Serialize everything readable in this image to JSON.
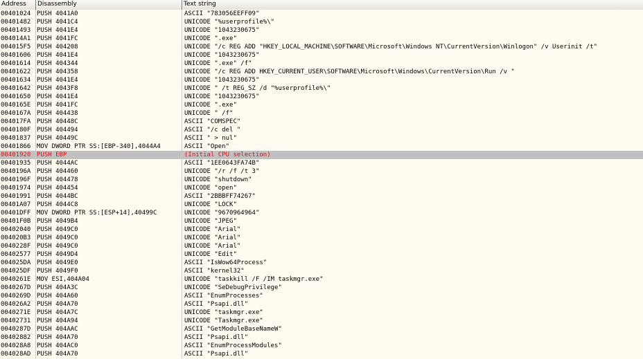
{
  "columns": {
    "address": "Address",
    "disassembly": "Disassembly",
    "text": "Text string"
  },
  "selection_color": "#ff0000",
  "rows": [
    {
      "addr": "00401024",
      "dis": "PUSH 4041A0",
      "txt": "ASCII \"783056EEFF09\""
    },
    {
      "addr": "00401482",
      "dis": "PUSH 4041C4",
      "txt": "UNICODE \"%userprofile%\\\""
    },
    {
      "addr": "00401493",
      "dis": "PUSH 4041E4",
      "txt": "UNICODE \"1043230675\""
    },
    {
      "addr": "004014A1",
      "dis": "PUSH 4041FC",
      "txt": "UNICODE \".exe\""
    },
    {
      "addr": "004015F5",
      "dis": "PUSH 404208",
      "txt": "UNICODE \"/c REG ADD \"HKEY_LOCAL_MACHINE\\SOFTWARE\\Microsoft\\Windows NT\\CurrentVersion\\Winlogon\" /v Userinit /t\""
    },
    {
      "addr": "00401606",
      "dis": "PUSH 4041E4",
      "txt": "UNICODE \"1043230675\""
    },
    {
      "addr": "00401614",
      "dis": "PUSH 404344",
      "txt": "UNICODE \".exe\" /f\""
    },
    {
      "addr": "00401622",
      "dis": "PUSH 404358",
      "txt": "UNICODE \"/c REG ADD HKEY_CURRENT_USER\\SOFTWARE\\Microsoft\\Windows\\CurrentVersion\\Run /v \""
    },
    {
      "addr": "00401634",
      "dis": "PUSH 4041E4",
      "txt": "UNICODE \"1043230675\""
    },
    {
      "addr": "00401642",
      "dis": "PUSH 4043F8",
      "txt": "UNICODE \" /t REG_SZ /d \"%userprofile%\\\""
    },
    {
      "addr": "00401650",
      "dis": "PUSH 4041E4",
      "txt": "UNICODE \"1043230675\""
    },
    {
      "addr": "0040165E",
      "dis": "PUSH 4041FC",
      "txt": "UNICODE \".exe\""
    },
    {
      "addr": "0040167A",
      "dis": "PUSH 404438",
      "txt": "UNICODE \" /f\""
    },
    {
      "addr": "004017FA",
      "dis": "PUSH 40448C",
      "txt": "ASCII \"COMSPEC\""
    },
    {
      "addr": "0040180F",
      "dis": "PUSH 404494",
      "txt": "ASCII \"/c del \""
    },
    {
      "addr": "00401837",
      "dis": "PUSH 40449C",
      "txt": "ASCII \" > nul\""
    },
    {
      "addr": "00401866",
      "dis": "MOV DWORD PTR SS:[EBP-340],4044A4",
      "txt": "ASCII \"Open\""
    },
    {
      "addr": "00401920",
      "dis": "PUSH EBP",
      "txt": "(Initial CPU selection)",
      "selected": true
    },
    {
      "addr": "00401935",
      "dis": "PUSH 4044AC",
      "txt": "ASCII \"1EE0643FA74B\""
    },
    {
      "addr": "0040196A",
      "dis": "PUSH 404460",
      "txt": "UNICODE \"/r /f /t 3\""
    },
    {
      "addr": "0040196F",
      "dis": "PUSH 404478",
      "txt": "UNICODE \"shutdown\""
    },
    {
      "addr": "00401974",
      "dis": "PUSH 404454",
      "txt": "UNICODE \"open\""
    },
    {
      "addr": "00401991",
      "dis": "PUSH 4044BC",
      "txt": "ASCII \"2BBBFF74267\""
    },
    {
      "addr": "00401A07",
      "dis": "PUSH 4044C8",
      "txt": "UNICODE \"LOCK\""
    },
    {
      "addr": "00401DFF",
      "dis": "MOV DWORD PTR SS:[ESP+14],40499C",
      "txt": "UNICODE \"9670964964\""
    },
    {
      "addr": "00401F0B",
      "dis": "PUSH 4049B4",
      "txt": "UNICODE \"JPEG\""
    },
    {
      "addr": "00402040",
      "dis": "PUSH 4049C0",
      "txt": "UNICODE \"Arial\""
    },
    {
      "addr": "004020B3",
      "dis": "PUSH 4049C0",
      "txt": "UNICODE \"Arial\""
    },
    {
      "addr": "0040228F",
      "dis": "PUSH 4049C0",
      "txt": "UNICODE \"Arial\""
    },
    {
      "addr": "00402577",
      "dis": "PUSH 4049D4",
      "txt": "UNICODE \"Edit\""
    },
    {
      "addr": "004025DA",
      "dis": "PUSH 4049E0",
      "txt": "ASCII \"IsWow64Process\""
    },
    {
      "addr": "004025DF",
      "dis": "PUSH 4049F0",
      "txt": "ASCII \"kernel32\""
    },
    {
      "addr": "0040261E",
      "dis": "MOV ESI,404A04",
      "txt": "UNICODE \"taskkill /F /IM taskmgr.exe\""
    },
    {
      "addr": "0040267D",
      "dis": "PUSH 404A3C",
      "txt": "UNICODE \"SeDebugPrivilege\""
    },
    {
      "addr": "0040269D",
      "dis": "PUSH 404A60",
      "txt": "ASCII \"EnumProcesses\""
    },
    {
      "addr": "004026A2",
      "dis": "PUSH 404A70",
      "txt": "ASCII \"Psapi.dll\""
    },
    {
      "addr": "0040271E",
      "dis": "PUSH 404A7C",
      "txt": "UNICODE \"taskmgr.exe\""
    },
    {
      "addr": "00402731",
      "dis": "PUSH 404A94",
      "txt": "UNICODE \"Taskmgr.exe\""
    },
    {
      "addr": "0040287D",
      "dis": "PUSH 404AAC",
      "txt": "ASCII \"GetModuleBaseNameW\""
    },
    {
      "addr": "00402882",
      "dis": "PUSH 404A70",
      "txt": "ASCII \"Psapi.dll\""
    },
    {
      "addr": "004028A8",
      "dis": "PUSH 404AC0",
      "txt": "ASCII \"EnumProcessModules\""
    },
    {
      "addr": "004028AD",
      "dis": "PUSH 404A70",
      "txt": "ASCII \"Psapi.dll\""
    }
  ]
}
